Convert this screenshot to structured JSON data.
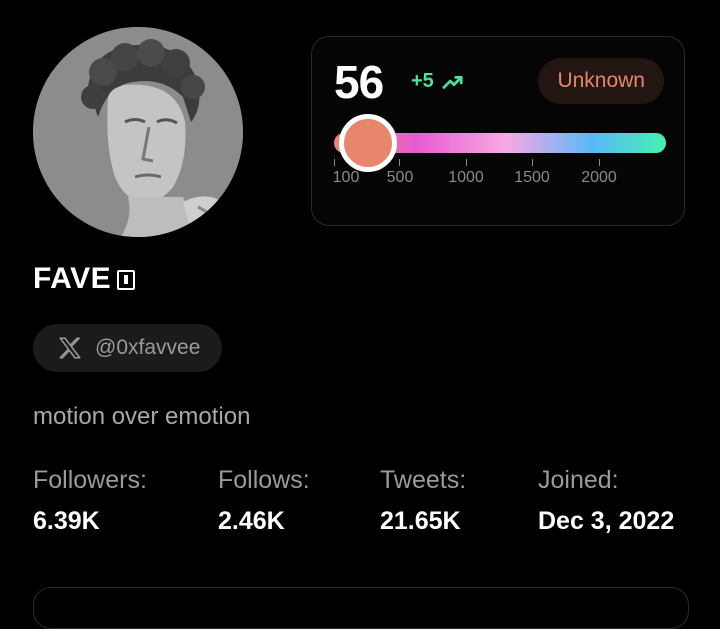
{
  "profile": {
    "avatar_alt": "statue bust",
    "name": "FAVE",
    "handle": "@0xfavvee",
    "bio": "motion over emotion"
  },
  "score": {
    "value": "56",
    "delta": "+5",
    "badge": "Unknown",
    "scale_ticks": [
      "100",
      "500",
      "1000",
      "1500",
      "2000"
    ],
    "colors": {
      "accent": "#e8866c",
      "delta": "#4be39a",
      "gradient": [
        "#e8866c",
        "#e85cd2",
        "#f7a9e4",
        "#58b9f7",
        "#46f0b0"
      ]
    }
  },
  "stats": [
    {
      "label": "Followers:",
      "value": "6.39K"
    },
    {
      "label": "Follows:",
      "value": "2.46K"
    },
    {
      "label": "Tweets:",
      "value": "21.65K"
    },
    {
      "label": "Joined:",
      "value": "Dec 3, 2022"
    }
  ],
  "icons": {
    "trend": "trending-up-icon",
    "x": "x-logo-icon",
    "badge": "verified-badge-icon"
  }
}
